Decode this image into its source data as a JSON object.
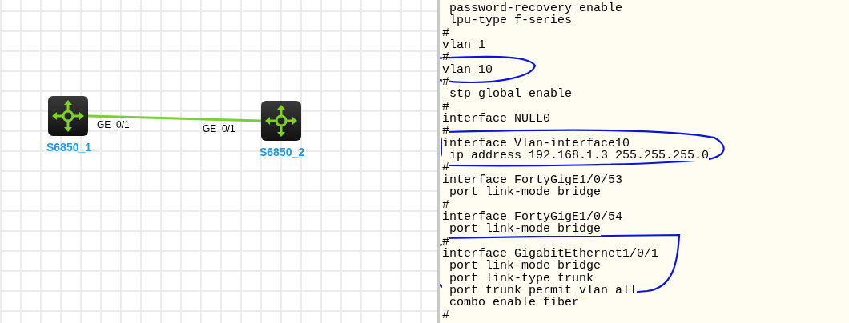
{
  "topology": {
    "nodes": [
      {
        "label": "S6850_1"
      },
      {
        "label": "S6850_2"
      }
    ],
    "links": [
      {
        "from_port": "GE_0/1",
        "to_port": "GE_0/1"
      }
    ]
  },
  "config": {
    "lines": [
      " password-recovery enable",
      " lpu-type f-series",
      "#",
      "vlan 1",
      "#",
      "vlan 10",
      "#",
      " stp global enable",
      "#",
      "interface NULL0",
      "#",
      "interface Vlan-interface10",
      " ip address 192.168.1.3 255.255.255.0",
      "#",
      "interface FortyGigE1/0/53",
      " port link-mode bridge",
      "#",
      "interface FortyGigE1/0/54",
      " port link-mode bridge",
      "#",
      "interface GigabitEthernet1/0/1",
      " port link-mode bridge",
      " port link-type trunk",
      " port trunk permit vlan all",
      " combo enable fiber",
      "#"
    ]
  }
}
